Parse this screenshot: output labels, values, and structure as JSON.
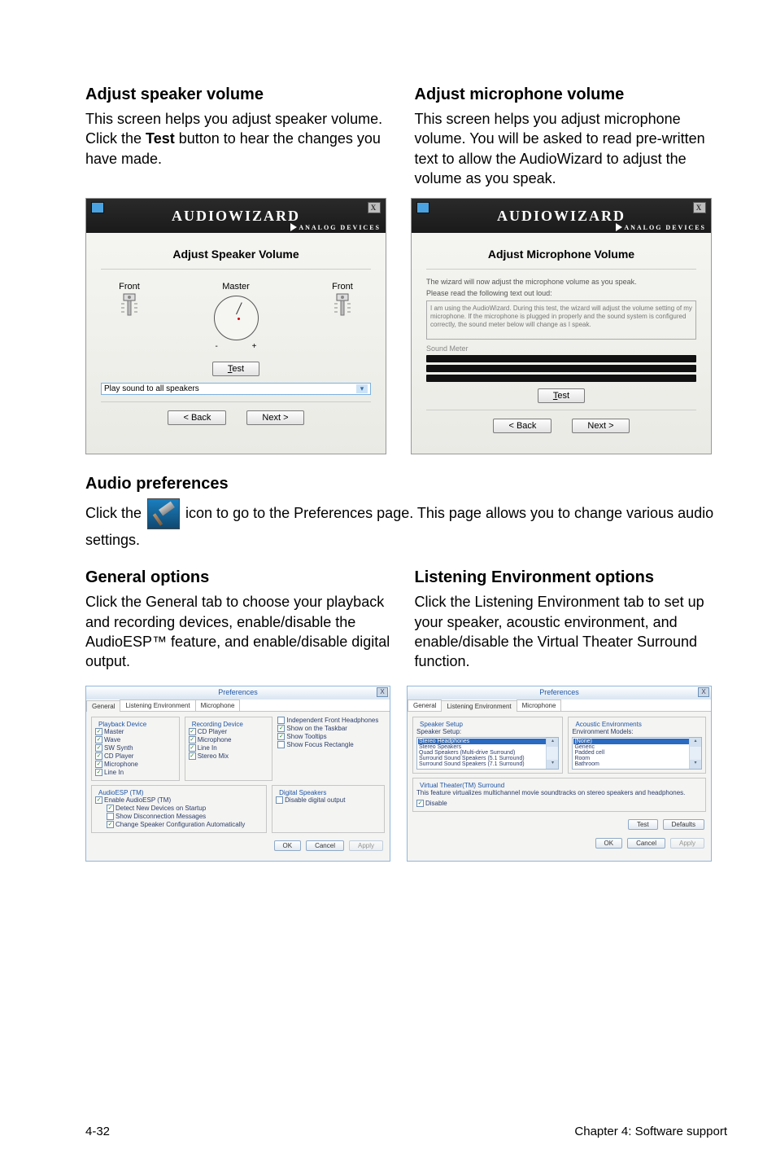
{
  "sections": {
    "adjust_speaker": {
      "heading": "Adjust speaker volume",
      "text_1": "This screen helps you adjust speaker volume. Click the ",
      "text_bold": "Test",
      "text_2": " button to hear the changes you have made."
    },
    "adjust_mic": {
      "heading": "Adjust microphone volume",
      "text": "This screen helps you adjust microphone volume. You will be asked to read pre-written text to allow the AudioWizard to adjust the volume as you speak."
    },
    "audio_prefs": {
      "heading": "Audio preferences",
      "text_1": "Click the ",
      "text_2": " icon to go to the Preferences page. This page allows you to change various audio settings."
    },
    "general_opts": {
      "heading": "General options",
      "text": "Click the General tab to choose your playback and recording devices, enable/disable the AudioESP™ feature, and enable/disable digital output."
    },
    "listening_env": {
      "heading": "Listening Environment options",
      "text": "Click the Listening Environment tab to set up your speaker, acoustic environment, and enable/disable the Virtual Theater Surround function."
    }
  },
  "wizard_speaker": {
    "app_title": "AUDIOWIZARD",
    "brand": "ANALOG DEVICES",
    "subtitle": "Adjust Speaker Volume",
    "front_left": "Front",
    "front_right": "Front",
    "master": "Master",
    "minus": "-",
    "plus": "+",
    "test_btn": "Test",
    "select_text": "Play sound to all speakers",
    "back_btn": "< Back",
    "next_btn": "Next >"
  },
  "wizard_mic": {
    "app_title": "AUDIOWIZARD",
    "brand": "ANALOG DEVICES",
    "subtitle": "Adjust Microphone Volume",
    "info1": "The wizard will now adjust the microphone volume as you speak.",
    "info2": "Please read the following text out loud:",
    "sample_text": "I am using the AudioWizard. During this test, the wizard will adjust the volume setting of my microphone. If the microphone is plugged in properly and the sound system is configured correctly, the sound meter below will change as I speak.",
    "sound_meter_label": "Sound Meter",
    "test_btn": "Test",
    "back_btn": "< Back",
    "next_btn": "Next >"
  },
  "prefs_general": {
    "title": "Preferences",
    "tabs": {
      "general": "General",
      "listening": "Listening Environment",
      "microphone": "Microphone"
    },
    "playback_legend": "Playback Device",
    "playback_items": [
      "Master",
      "Wave",
      "SW Synth",
      "CD Player",
      "Microphone",
      "Line In"
    ],
    "recording_legend": "Recording Device",
    "recording_items": [
      "CD Player",
      "Microphone",
      "Line In",
      "Stereo Mix"
    ],
    "front_hp_legend": "",
    "front_hp_items": [
      "Independent Front Headphones",
      "Show on the Taskbar",
      "Show Tooltips",
      "Show Focus Rectangle"
    ],
    "front_hp_checked": [
      false,
      true,
      true,
      false
    ],
    "audioesp_legend": "AudioESP (TM)",
    "audioesp_enable": "Enable AudioESP (TM)",
    "audioesp_items": [
      "Detect New Devices on Startup",
      "Show Disconnection Messages",
      "Change Speaker Configuration Automatically"
    ],
    "audioesp_checked": [
      true,
      false,
      true
    ],
    "digital_legend": "Digital Speakers",
    "digital_item": "Disable digital output",
    "ok_btn": "OK",
    "cancel_btn": "Cancel",
    "apply_btn": "Apply"
  },
  "prefs_listening": {
    "title": "Preferences",
    "tabs": {
      "general": "General",
      "listening": "Listening Environment",
      "microphone": "Microphone"
    },
    "speaker_setup_legend": "Speaker Setup",
    "speaker_setup_label": "Speaker Setup:",
    "speaker_options": [
      "Stereo Headphones",
      "Stereo Speakers",
      "Quad Speakers (Multi-drive Surround)",
      "Surround Sound Speakers (5.1 Surround)",
      "Surround Sound Speakers (7.1 Surround)"
    ],
    "speaker_selected_index": 0,
    "acoustic_legend": "Acoustic Environments",
    "acoustic_label": "Environment Models:",
    "acoustic_options": [
      "(None)",
      "Generic",
      "Padded cell",
      "Room",
      "Bathroom"
    ],
    "acoustic_selected_index": 0,
    "virtual_legend": "Virtual Theater(TM) Surround",
    "virtual_desc": "This feature virtualizes multichannel movie soundtracks on stereo speakers and headphones.",
    "virtual_disable": "Disable",
    "test_btn": "Test",
    "defaults_btn": "Defaults",
    "ok_btn": "OK",
    "cancel_btn": "Cancel",
    "apply_btn": "Apply"
  },
  "footer": {
    "left": "4-32",
    "right": "Chapter 4: Software support"
  }
}
